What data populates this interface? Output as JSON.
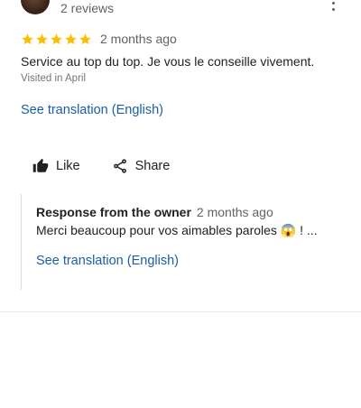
{
  "reviewer": {
    "reviews_count": "2 reviews"
  },
  "review": {
    "rating": 5,
    "rating_max": 5,
    "time_ago": "2 months ago",
    "text": "Service au top du top. Je vous le conseille vivement.",
    "visited": "Visited in April",
    "translate_link": "See translation (English)"
  },
  "actions": {
    "like_label": "Like",
    "share_label": "Share"
  },
  "owner_response": {
    "title": "Response from the owner",
    "time_ago": "2 months ago",
    "text_before_emoji": "Merci beaucoup pour vos aimables paroles ",
    "emoji": "😱",
    "text_after_emoji": " ! ...",
    "translate_link": "See translation (English)"
  },
  "colors": {
    "star": "#fbbc04",
    "link": "#1a5ea8",
    "secondary_text": "#5f6368"
  },
  "icons": [
    "more-vert-icon",
    "star-icon",
    "thumb-up-icon",
    "share-icon"
  ]
}
